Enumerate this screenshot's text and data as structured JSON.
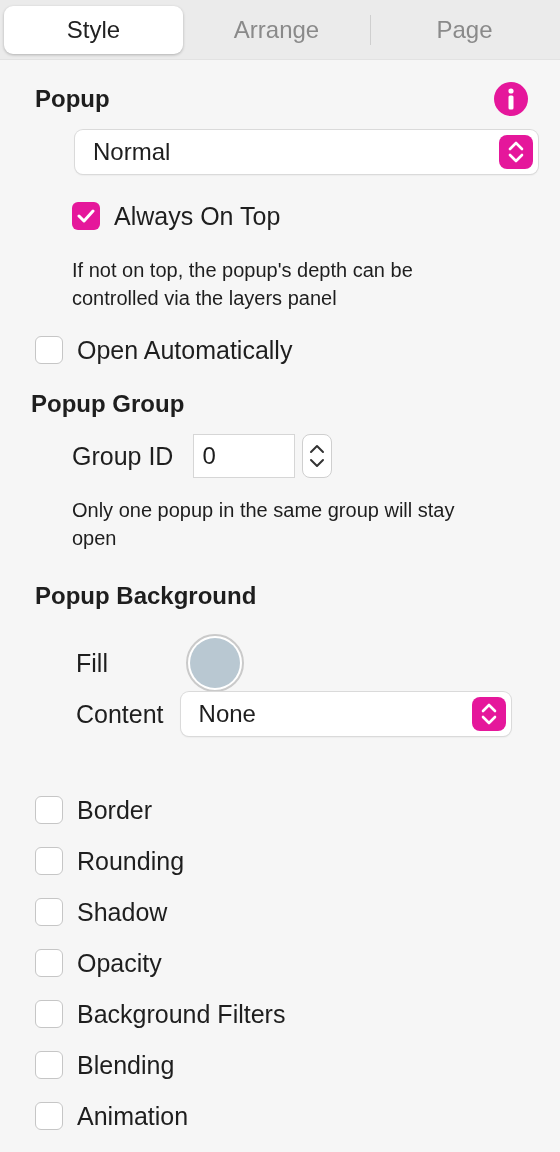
{
  "tabs": [
    {
      "label": "Style",
      "selected": true
    },
    {
      "label": "Arrange",
      "selected": false
    },
    {
      "label": "Page",
      "selected": false
    }
  ],
  "popup": {
    "title": "Popup",
    "mode_select": {
      "value": "Normal"
    },
    "always_on_top": {
      "label": "Always On Top",
      "checked": true
    },
    "note": "If not on top, the popup's depth can be controlled via the layers panel",
    "open_automatically": {
      "label": "Open Automatically",
      "checked": false
    }
  },
  "popup_group": {
    "title": "Popup Group",
    "group_id": {
      "label": "Group ID",
      "value": "0"
    },
    "note": "Only one popup in the same group will stay open"
  },
  "popup_background": {
    "title": "Popup Background",
    "fill": {
      "label": "Fill",
      "color": "#b9c8d2"
    },
    "content": {
      "label": "Content",
      "value": "None"
    }
  },
  "options": [
    {
      "label": "Border",
      "checked": false
    },
    {
      "label": "Rounding",
      "checked": false
    },
    {
      "label": "Shadow",
      "checked": false
    },
    {
      "label": "Opacity",
      "checked": false
    },
    {
      "label": "Background Filters",
      "checked": false
    },
    {
      "label": "Blending",
      "checked": false
    },
    {
      "label": "Animation",
      "checked": false
    }
  ]
}
